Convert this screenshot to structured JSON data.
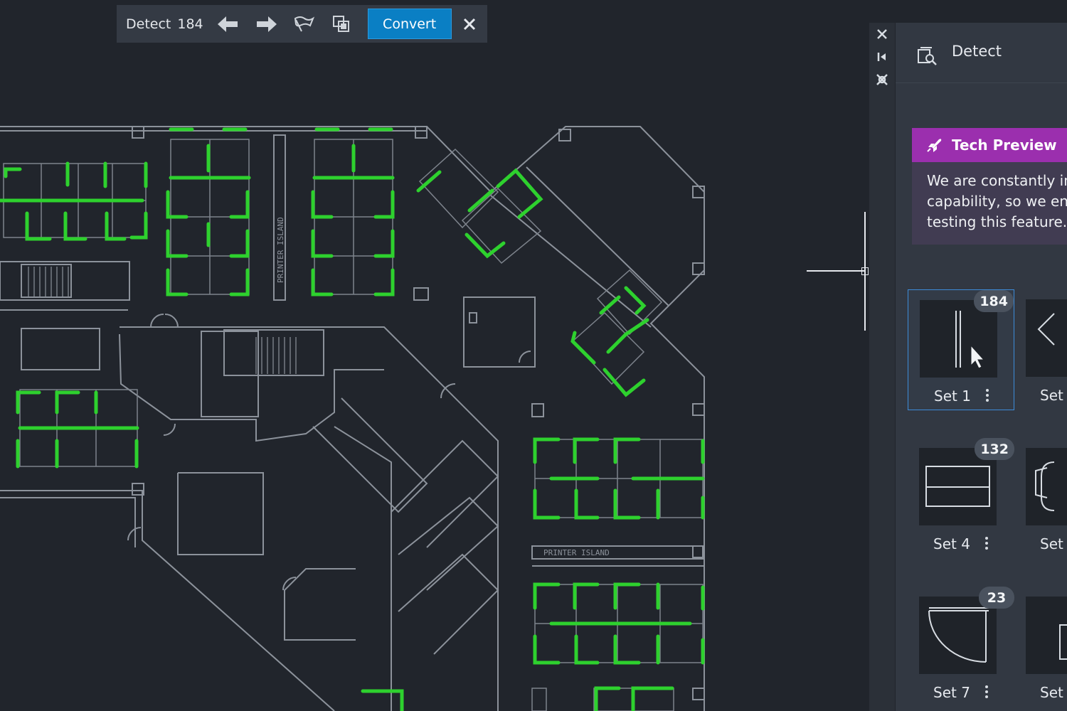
{
  "toolbar": {
    "detect_label": "Detect",
    "detect_count": "184",
    "convert_label": "Convert",
    "icons": [
      "arrow-left-icon",
      "arrow-right-icon",
      "flag-icon",
      "copy-selection-icon",
      "close-icon"
    ]
  },
  "drawing": {
    "label_printer_island_1": "PRINTER ISLAND",
    "label_printer_island_2": "PRINTER ISLAND"
  },
  "rail": {
    "icons": [
      "close-icon",
      "collapse-panel-icon",
      "settings-icon"
    ]
  },
  "panel": {
    "title": "Detect",
    "title_icon": "detect-search-icon",
    "tech_preview": {
      "title": "Tech Preview",
      "icon": "rocket-icon",
      "lines": [
        "We are constantly im",
        "capability, so we enc",
        "testing this feature."
      ]
    },
    "sets": [
      {
        "label": "Set 1",
        "count": "184",
        "selected": true
      },
      {
        "label": "Set",
        "count": ""
      },
      {
        "label": "Set 4",
        "count": "132"
      },
      {
        "label": "Set",
        "count": ""
      },
      {
        "label": "Set 7",
        "count": "23"
      },
      {
        "label": "Set",
        "count": ""
      }
    ]
  },
  "colors": {
    "accent_blue": "#0a7fc4",
    "detected_green": "#2ed12e",
    "preview_purple": "#9b2fae",
    "linework": "#8f959e",
    "background": "#21252c"
  }
}
